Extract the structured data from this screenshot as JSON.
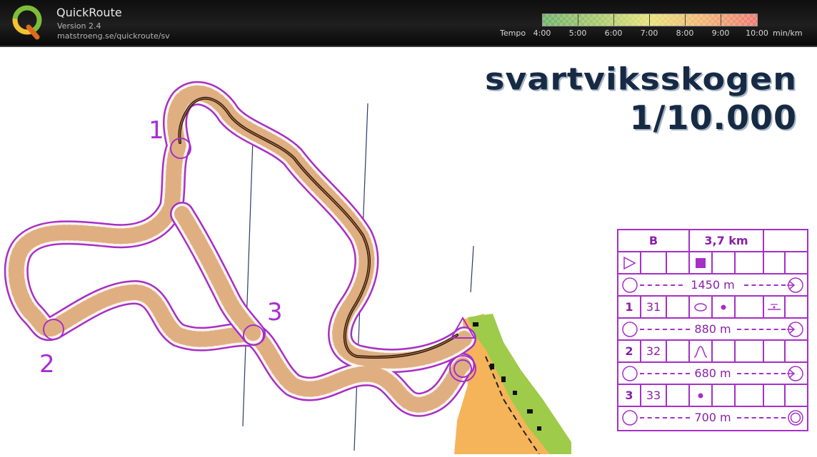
{
  "app": {
    "title": "QuickRoute",
    "version": "Version 2.4",
    "url": "matstroeng.se/quickroute/sv"
  },
  "pace_scale": {
    "label": "Tempo",
    "ticks": [
      "4:00",
      "5:00",
      "6:00",
      "7:00",
      "8:00",
      "9:00",
      "10:00"
    ],
    "unit": "min/km",
    "colors": [
      "#6fb36a",
      "#a8c86d",
      "#e6e277",
      "#f1b574",
      "#ee7a70"
    ]
  },
  "map": {
    "title": "svartviksskogen",
    "scale": "1/10.000",
    "course_color": "#a62fc8",
    "control_numbers": [
      "1",
      "2",
      "3"
    ]
  },
  "description_sheet": {
    "header": {
      "class": "B",
      "length": "3,7 km"
    },
    "legs": [
      {
        "number": "1",
        "code": "31",
        "distance_before": "1450 m"
      },
      {
        "number": "2",
        "code": "32",
        "distance_before": "880 m"
      },
      {
        "number": "3",
        "code": "33",
        "distance_before": "680 m"
      }
    ],
    "finish_distance": "700 m"
  }
}
